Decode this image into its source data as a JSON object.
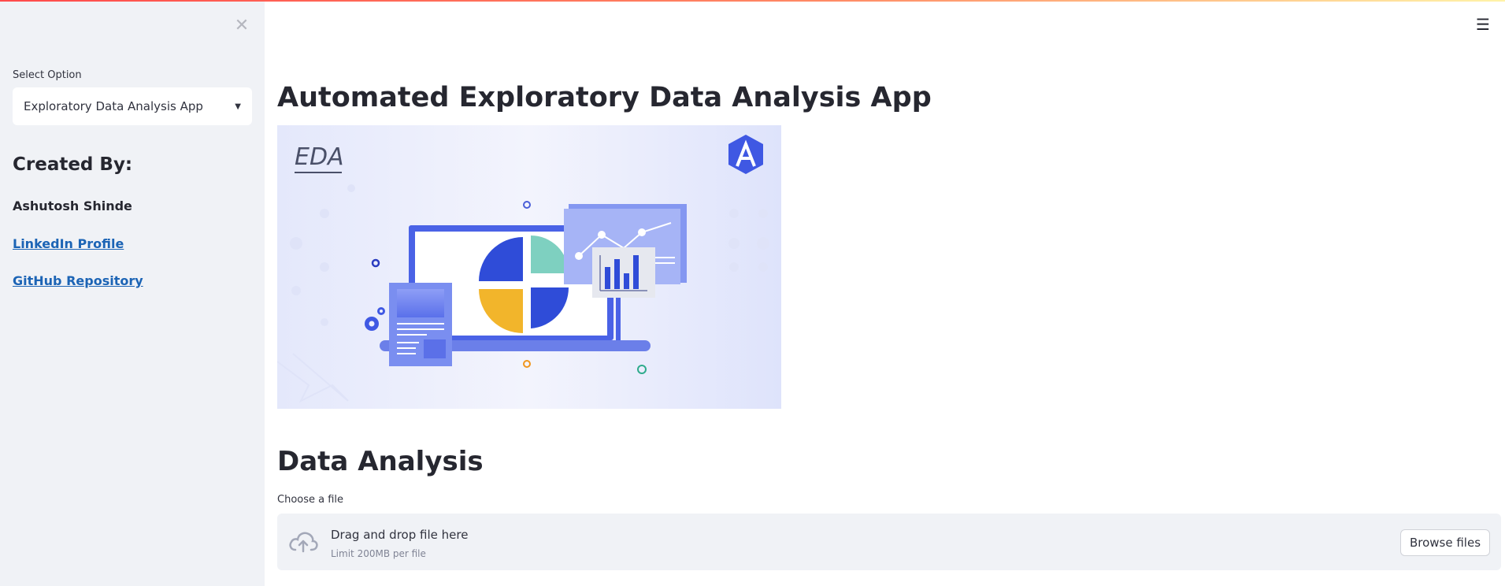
{
  "sidebar": {
    "select_label": "Select Option",
    "select_value": "Exploratory Data Analysis App",
    "created_by": "Created By:",
    "author": "Ashutosh Shinde",
    "links": [
      "LinkedIn Profile",
      "GitHub Repository"
    ]
  },
  "main": {
    "title": "Automated Exploratory Data Analysis App",
    "banner_text": "EDA",
    "section_title": "Data Analysis",
    "uploader": {
      "label": "Choose a file",
      "drop_text": "Drag and drop file here",
      "limit_text": "Limit 200MB per file",
      "browse_label": "Browse files"
    }
  },
  "icons": {
    "close": "close-icon",
    "menu": "hamburger-menu-icon",
    "upload": "cloud-upload-icon",
    "caret": "caret-down-icon"
  },
  "colors": {
    "sidebar_bg": "#f0f2f6",
    "link": "#1c64b5",
    "primary_text": "#262730",
    "banner_accent": "#3f58e3"
  }
}
